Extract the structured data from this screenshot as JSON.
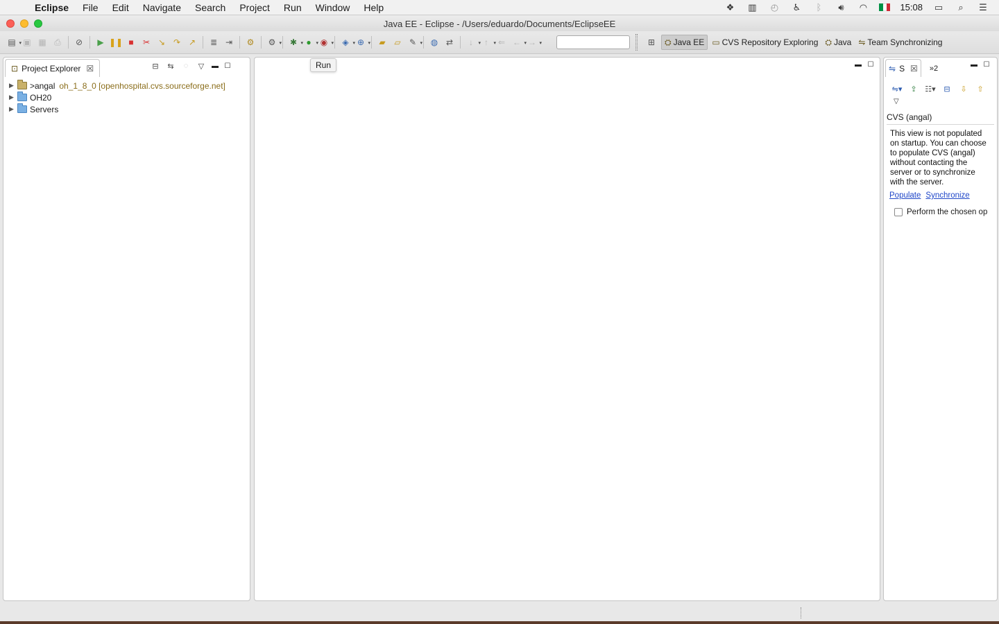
{
  "menubar": {
    "app_name": "Eclipse",
    "items": [
      "File",
      "Edit",
      "Navigate",
      "Search",
      "Project",
      "Run",
      "Window",
      "Help"
    ],
    "clock": "15:08",
    "status_icons": [
      "dropbox-icon",
      "battery-monitor-icon",
      "time-machine-icon",
      "accessibility-icon",
      "bluetooth-icon",
      "volume-icon",
      "wifi-icon",
      "italy-flag-icon",
      "battery-icon",
      "spotlight-icon",
      "notification-center-icon"
    ]
  },
  "window": {
    "title": "Java EE - Eclipse - /Users/eduardo/Documents/EclipseEE"
  },
  "toolbar": {
    "quick_access_value": "",
    "perspectives": [
      {
        "label": "Java EE",
        "active": true
      },
      {
        "label": "CVS Repository Exploring",
        "active": false
      },
      {
        "label": "Java",
        "active": false
      },
      {
        "label": "Team Synchronizing",
        "active": false
      }
    ]
  },
  "tooltip": {
    "text": "Run"
  },
  "project_explorer": {
    "tab_label": "Project Explorer",
    "items": [
      {
        "name": ">angal",
        "repo": "oh_1_8_0 [openhospital.cvs.sourceforge.net]"
      },
      {
        "name": "OH20",
        "repo": ""
      },
      {
        "name": "Servers",
        "repo": ""
      }
    ]
  },
  "synchronize_view": {
    "tab_label": "S",
    "overflow_label": "»2",
    "title": "CVS (angal)",
    "message": "This view is not populated on startup. You can choose to populate CVS (angal) without contacting the server or to synchronize with the server.",
    "populate_link": "Populate",
    "synchronize_link": "Synchronize",
    "checkbox_label": "Perform the chosen op",
    "checkbox_checked": false
  },
  "colors": {
    "link": "#1f46c8",
    "repo_decoration": "#8a6d1a",
    "close_red": "#fc5f57",
    "minimize_yellow": "#fdbc2e",
    "zoom_green": "#28c840"
  }
}
